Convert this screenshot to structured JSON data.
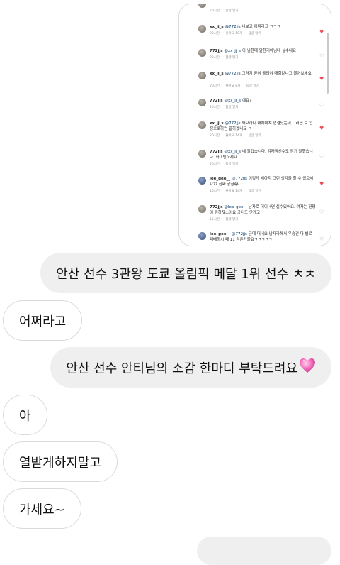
{
  "screenshot": {
    "comments": [
      {
        "user": "",
        "mention": "",
        "text": "",
        "time": "20시간",
        "likes": "",
        "reply": "답글 달기",
        "liked": false,
        "avatar": "gray"
      },
      {
        "user": "xx_jj_s",
        "mention": "@772jjs",
        "text": "니보고 어쩌라고 ㅋㅋㅋ",
        "time": "20시간",
        "likes": "좋아요 19개",
        "reply": "답글 달기",
        "liked": true,
        "avatar": "gray"
      },
      {
        "user": "772jjs",
        "mention": "@xx_jj_s",
        "text": "아 님한테 말한거아님데 실수네요",
        "time": "20시간",
        "likes": "",
        "reply": "답글 달기",
        "liked": false,
        "avatar": "gray"
      },
      {
        "user": "xx_jj_s",
        "mention": "@772jjs",
        "text": "그러기 굳이 올려야 대회같나고 물어보세요",
        "time": "20시간",
        "likes": "좋아요 8개",
        "reply": "답글 달기",
        "liked": true,
        "avatar": "gray"
      },
      {
        "user": "772jjs",
        "mention": "@xx_jj_s",
        "text": "예요?",
        "time": "20시간",
        "likes": "",
        "reply": "답글 달기",
        "liked": false,
        "avatar": "gray"
      },
      {
        "user": "xx_jj_s",
        "mention": "@772jjs",
        "text": "왜요하니 대체이치 연결났는데 그러곤 로 인정으로하면 끝하겠니요 ㅋ",
        "time": "20시간",
        "likes": "좋아요 14개",
        "reply": "답글 달기",
        "liked": true,
        "avatar": "gray"
      },
      {
        "user": "772jjs",
        "mention": "@xx_jj_s",
        "text": "네 알겠습니다. 김재칙선수도 경기 잘했습니다. 화이팅하세요.",
        "time": "20시간",
        "likes": "",
        "reply": "답글 달기",
        "liked": false,
        "avatar": "gray"
      },
      {
        "user": "lee_gee__",
        "mention": "@772jjs",
        "text": "어떻게 배아지 그런 생각을 할 수 있으세요?? 진짜 궁금😂",
        "time": "16시간",
        "likes": "좋아요 14개",
        "reply": "답글 달기",
        "liked": true,
        "avatar": "blue"
      },
      {
        "user": "772jjs",
        "mention": "@lee_gee__",
        "text": "남자로 데이너면 실수있어요. 여자는 한명이 편하잖스이요 궁더도 안가고",
        "time": "15시간",
        "likes": "",
        "reply": "답글 달기",
        "liked": false,
        "avatar": "gray"
      },
      {
        "user": "lee_gee__",
        "mention": "@772jjs",
        "text": "근데 대네요 남자라해서 우승건 다 별로 패배하시 째 11 작든거볼요ㅋㅋㅋㅋㅋ",
        "time": "",
        "likes": "",
        "reply": "",
        "liked": false,
        "avatar": "blue"
      }
    ]
  },
  "messages": [
    {
      "side": "me",
      "text": "안산 선수 3관왕 도쿄 올림픽 메달 1위 선수 ㅊㅊ"
    },
    {
      "side": "them",
      "text": "어쩌라고"
    },
    {
      "side": "me",
      "text": "안산 선수 안티님의 소감 한마디 부탁드려요",
      "emoji": "pink-heart"
    },
    {
      "side": "them",
      "text": "아"
    },
    {
      "side": "them",
      "text": "열받게하지말고"
    },
    {
      "side": "them",
      "text": "가세요~"
    }
  ]
}
